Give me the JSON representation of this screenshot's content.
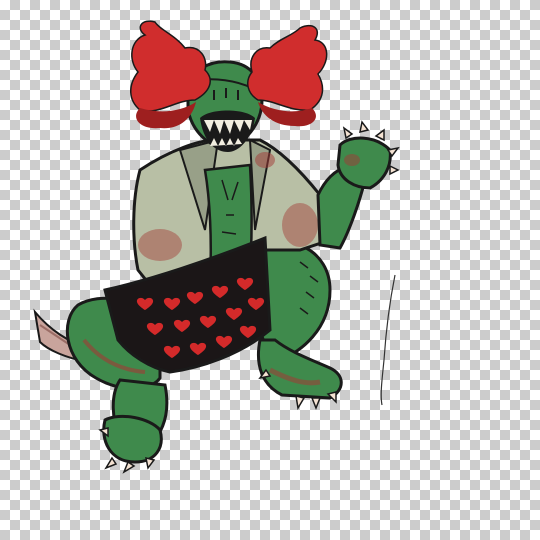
{
  "canvas": {
    "background": "transparency-checkerboard",
    "checker_colors": [
      "#ffffff",
      "#cccccc"
    ]
  },
  "illustration": {
    "subject": "green-monster-clown",
    "colors": {
      "skin": "#3f8a4c",
      "skin_dark": "#2d6b39",
      "hair": "#d02d2d",
      "hair_dark": "#9e1f1f",
      "jacket": "#b8bfa5",
      "jacket_shade": "#98a088",
      "shorts": "#1b1617",
      "hearts": "#d42a2a",
      "blood": "#a23a35",
      "outline": "#1a1a1a",
      "teeth": "#f2eee0",
      "claws": "#f4e2d2"
    }
  }
}
